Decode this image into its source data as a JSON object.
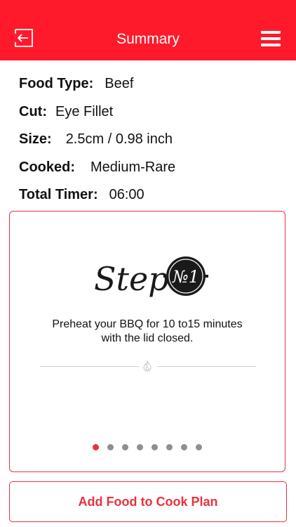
{
  "header": {
    "title": "Summary",
    "back_icon": "back-exit-icon",
    "menu_icon": "hamburger-menu-icon",
    "color": "#ff1a2b"
  },
  "summary": {
    "rows": [
      {
        "label": "Food Type:",
        "value": "Beef"
      },
      {
        "label": "Cut:",
        "value": "Eye Fillet"
      },
      {
        "label": "Size:",
        "value": "2.5cm / 0.98 inch"
      },
      {
        "label": "Cooked:",
        "value": "Medium-Rare"
      },
      {
        "label": "Total Timer:",
        "value": "06:00"
      }
    ]
  },
  "step": {
    "logo_word": "Step",
    "logo_badge": "№1",
    "text_line1": "Preheat your BBQ for 10 to15 minutes",
    "text_line2": "with the lid closed.",
    "divider_icon": "flame-icon",
    "pager": {
      "total": 8,
      "current": 1
    }
  },
  "actions": {
    "add_label": "Add Food to Cook Plan"
  },
  "colors": {
    "accent": "#e8323f",
    "inactive_dot": "#8f8f8f"
  }
}
